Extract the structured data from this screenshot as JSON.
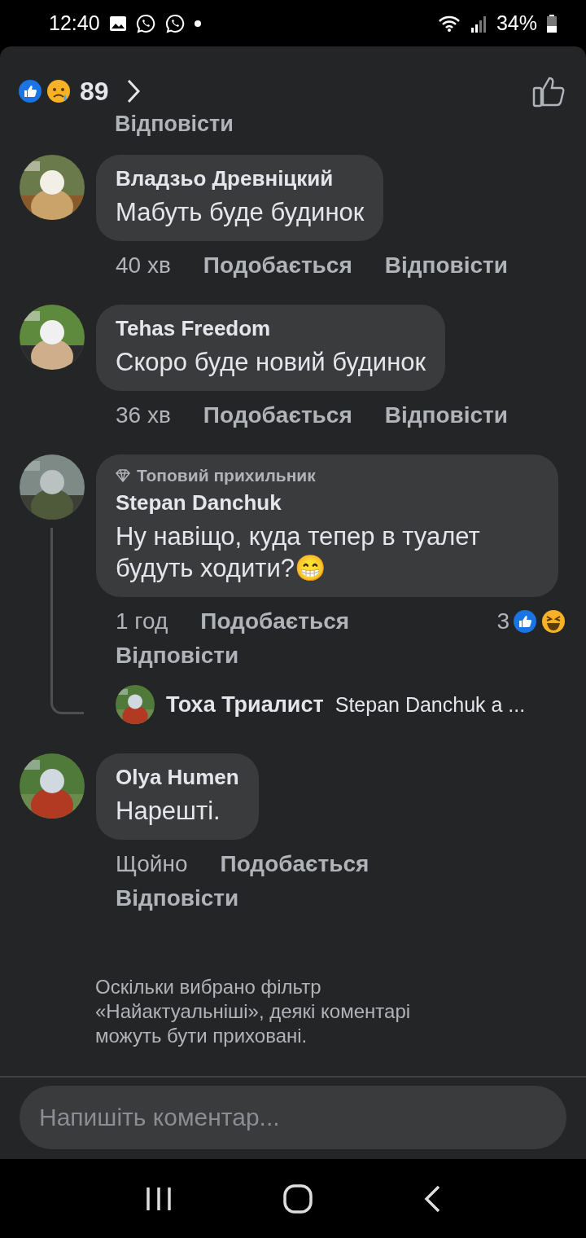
{
  "status_bar": {
    "time": "12:40",
    "battery": "34%"
  },
  "header": {
    "reaction_count": "89"
  },
  "top_reply_link": "Відповісти",
  "comments": [
    {
      "author": "Владзьо Древніцкий",
      "text": "Мабуть буде будинок",
      "time": "40 хв",
      "like": "Подобається",
      "reply": "Відповісти"
    },
    {
      "author": "Tehas Freedom",
      "text": "Скоро буде новий будинок",
      "time": "36 хв",
      "like": "Подобається",
      "reply": "Відповісти"
    },
    {
      "badge": "Топовий прихильник",
      "author": "Stepan Danchuk",
      "text": "Ну навіщо, куда тепер в туалет будуть ходити?",
      "emoji": "😁",
      "time": "1 год",
      "like": "Подобається",
      "reply": "Відповісти",
      "reaction_count": "3",
      "reply_preview": {
        "author": "Тоха Триалист",
        "text": "Stepan Danchuk а ..."
      }
    },
    {
      "author": "Olya  Humen",
      "text": "Нарешті.",
      "time": "Щойно",
      "like": "Подобається",
      "reply": "Відповісти"
    }
  ],
  "filter_notice": "Оскільки вибрано фільтр «Найактуальніші», деякі коментарі можуть бути приховані.",
  "composer": {
    "placeholder": "Напишіть коментар..."
  }
}
